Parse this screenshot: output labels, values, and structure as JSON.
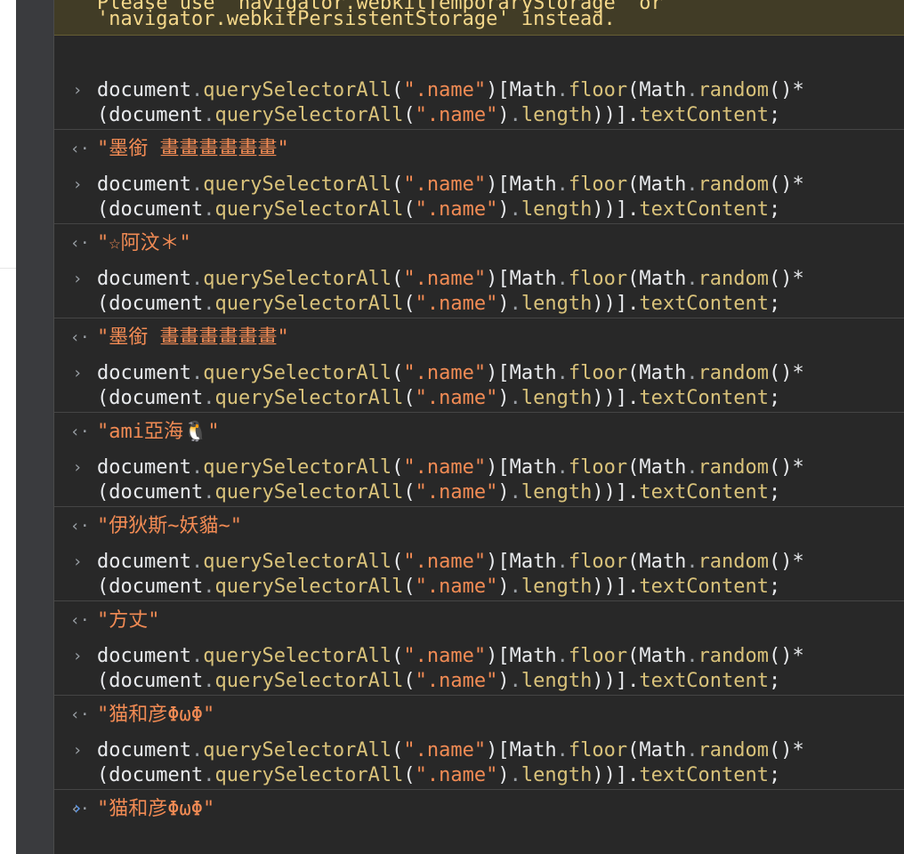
{
  "warning": {
    "line1": "Please use 'navigator.webkitTemporaryStorage' or",
    "line2": "'navigator.webkitPersistentStorage' instead."
  },
  "icons": {
    "input_marker": "chevron-right-icon",
    "output_marker": "return-arrow-icon",
    "prompt": "chevron-right-icon"
  },
  "glyphs": {
    "input_marker": "›",
    "output_marker": "‹·",
    "prompt": "›"
  },
  "colors": {
    "background": "#282828",
    "warning_background": "#413c26",
    "warning_text": "#f5d88b",
    "method": "#d9c27a",
    "string": "#f28b54",
    "identifier": "#e8eaed",
    "prompt": "#5e9bf0"
  },
  "code": {
    "document": "document",
    "dot": ".",
    "qsa": "querySelectorAll",
    "open": "(",
    "selector": "\".name\"",
    "close_bracket_open": ")[",
    "math": "Math",
    "floor": "floor",
    "random": "random",
    "random_call": "()*",
    "open_paren_line2": "(",
    "close_paren": ")",
    "length": "length",
    "tail": "))].",
    "textContent": "textContent",
    "semicolon": ";"
  },
  "results": [
    "\"墨銜 畫畫畫畫畫畫\"",
    "\"☆阿汶＊\"",
    "\"墨銜 畫畫畫畫畫畫\"",
    "\"ami亞海🐧\"",
    "\"伊狄斯~妖貓~\"",
    "\"方丈\"",
    "\"猫和彦ΦωΦ\"",
    "\"猫和彦ΦωΦ\""
  ]
}
